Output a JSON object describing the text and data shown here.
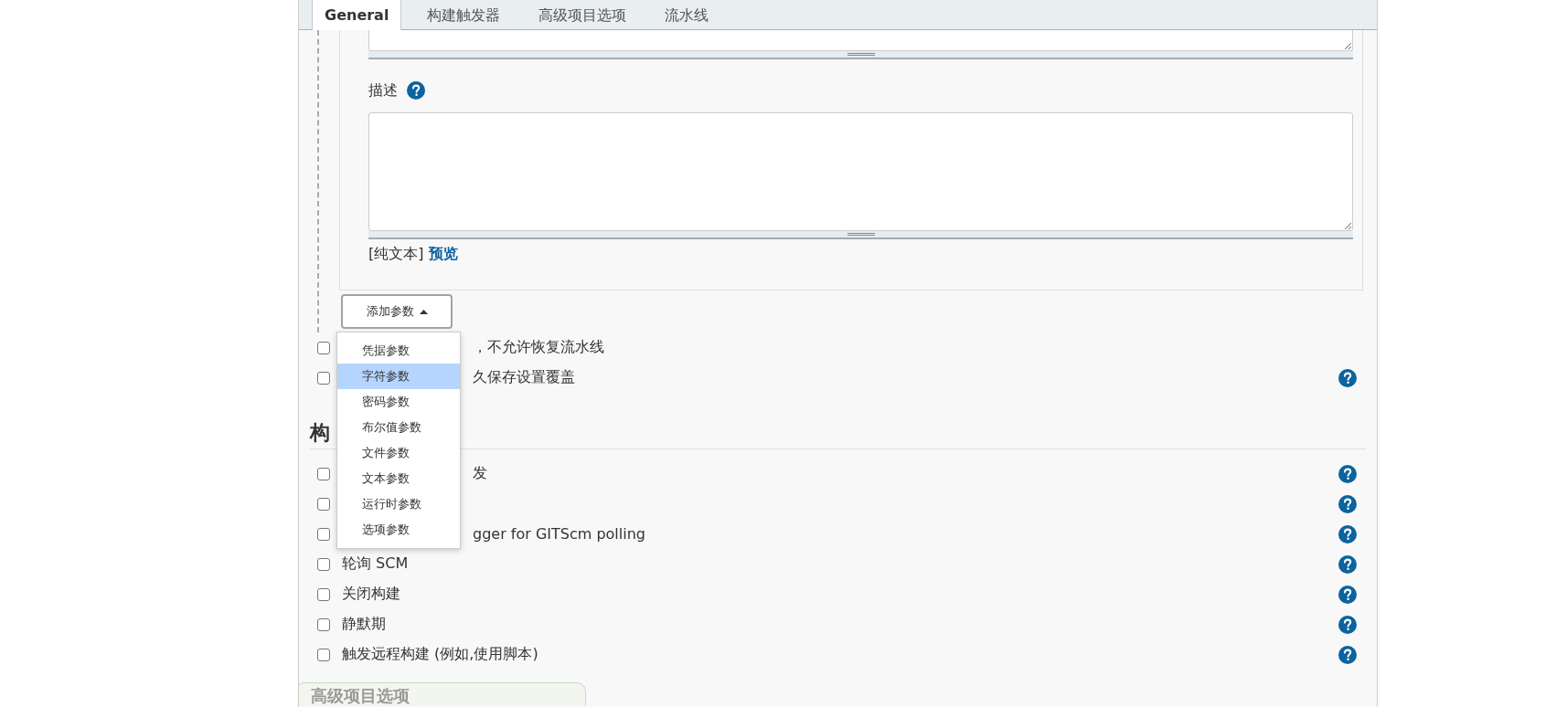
{
  "tabs": [
    {
      "label": "General",
      "selected": true
    },
    {
      "label": "构建触发器",
      "selected": false
    },
    {
      "label": "高级项目选项",
      "selected": false
    },
    {
      "label": "流水线",
      "selected": false
    }
  ],
  "parameter_box": {
    "description_label": "描述",
    "format_note": "[纯文本]",
    "preview_link": "预览"
  },
  "add_parameter_button": {
    "label": "添加参数",
    "expanded": true
  },
  "parameter_menu": [
    {
      "label": "凭据参数",
      "selected": false
    },
    {
      "label": "字符参数",
      "selected": true
    },
    {
      "label": "密码参数",
      "selected": false
    },
    {
      "label": "布尔值参数",
      "selected": false
    },
    {
      "label": "文件参数",
      "selected": false
    },
    {
      "label": "文本参数",
      "selected": false
    },
    {
      "label": "运行时参数",
      "selected": false
    },
    {
      "label": "选项参数",
      "selected": false
    }
  ],
  "general_options": [
    {
      "kind": "covered",
      "label": "，不允许恢复流水线",
      "checked": false,
      "help": false
    },
    {
      "kind": "covered",
      "label": "久保存设置覆盖",
      "checked": false,
      "help": true
    }
  ],
  "build_triggers": {
    "heading": "构",
    "options": [
      {
        "kind": "covered",
        "label": "发",
        "checked": false,
        "help": true
      },
      {
        "kind": "covered",
        "checked": false,
        "help": true
      },
      {
        "kind": "covered",
        "label": "gger for GITScm polling",
        "checked": false,
        "help": true
      },
      {
        "kind": "plain",
        "label": "轮询 SCM",
        "checked": false,
        "help": true
      },
      {
        "kind": "plain",
        "label": "关闭构建",
        "checked": false,
        "help": true
      },
      {
        "kind": "plain",
        "label": "静默期",
        "checked": false,
        "help": true
      },
      {
        "kind": "plain",
        "label": "触发远程构建 (例如,使用脚本)",
        "checked": false,
        "help": true
      }
    ]
  },
  "next_section": {
    "label": "高级项目选项"
  }
}
